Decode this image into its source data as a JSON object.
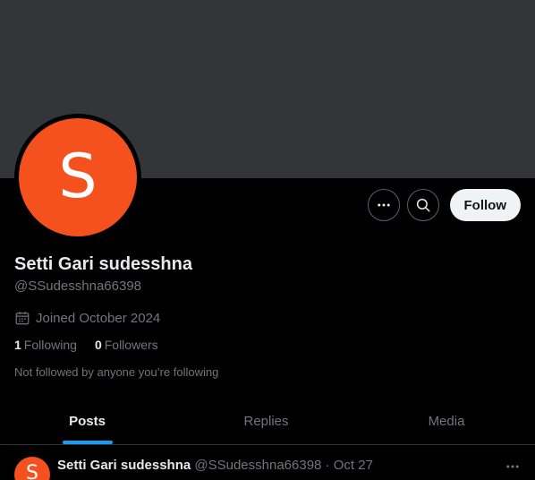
{
  "profile": {
    "avatar_letter": "S",
    "display_name": "Setti Gari sudesshna",
    "handle": "@SSudesshna66398",
    "joined": "Joined October 2024",
    "following_count": "1",
    "following_label": "Following",
    "followers_count": "0",
    "followers_label": "Followers",
    "not_followed_text": "Not followed by anyone you’re following"
  },
  "actions": {
    "more_icon": "more-horizontal-icon",
    "search_icon": "search-icon",
    "follow_label": "Follow"
  },
  "tabs": [
    {
      "label": "Posts",
      "active": true
    },
    {
      "label": "Replies",
      "active": false
    },
    {
      "label": "Media",
      "active": false
    }
  ],
  "post": {
    "avatar_letter": "S",
    "author_name": "Setti Gari sudesshna",
    "author_handle": "@SSudesshna66398",
    "separator": "·",
    "date": "Oct 27"
  },
  "colors": {
    "background": "#000000",
    "banner": "#333639",
    "avatar": "#f4511e",
    "accent": "#1d9bf0",
    "muted_text": "#71767b"
  }
}
